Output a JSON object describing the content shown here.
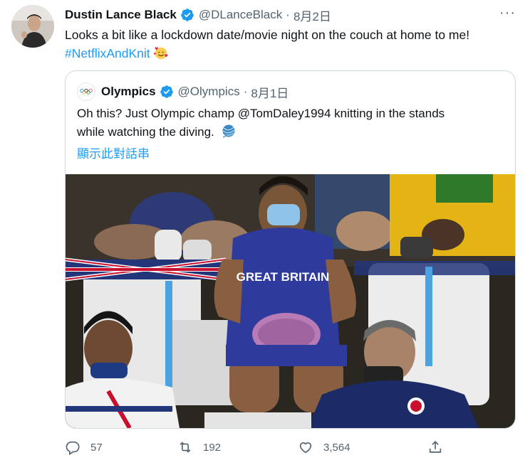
{
  "tweet": {
    "author_name": "Dustin Lance Black",
    "author_handle": "@DLanceBlack",
    "date": "8月2日",
    "separator": "·",
    "more_label": "···",
    "text": "Looks a bit like a lockdown date/movie night on the couch at home to me!",
    "hashtag": "#NetflixAndKnit"
  },
  "quoted": {
    "author_name": "Olympics",
    "author_handle": "@Olympics",
    "date": "8月1日",
    "separator": "·",
    "text_line1": "Oh this? Just Olympic champ @TomDaley1994 knitting in the stands",
    "text_line2": "while watching the diving.",
    "show_thread": "顯示此對話串",
    "photo_text": "GREAT BRITAIN"
  },
  "actions": {
    "replies": "57",
    "retweets": "192",
    "likes": "3,564"
  },
  "colors": {
    "link": "#1d9bf0",
    "secondary": "#536471",
    "border": "#cfd9de"
  }
}
